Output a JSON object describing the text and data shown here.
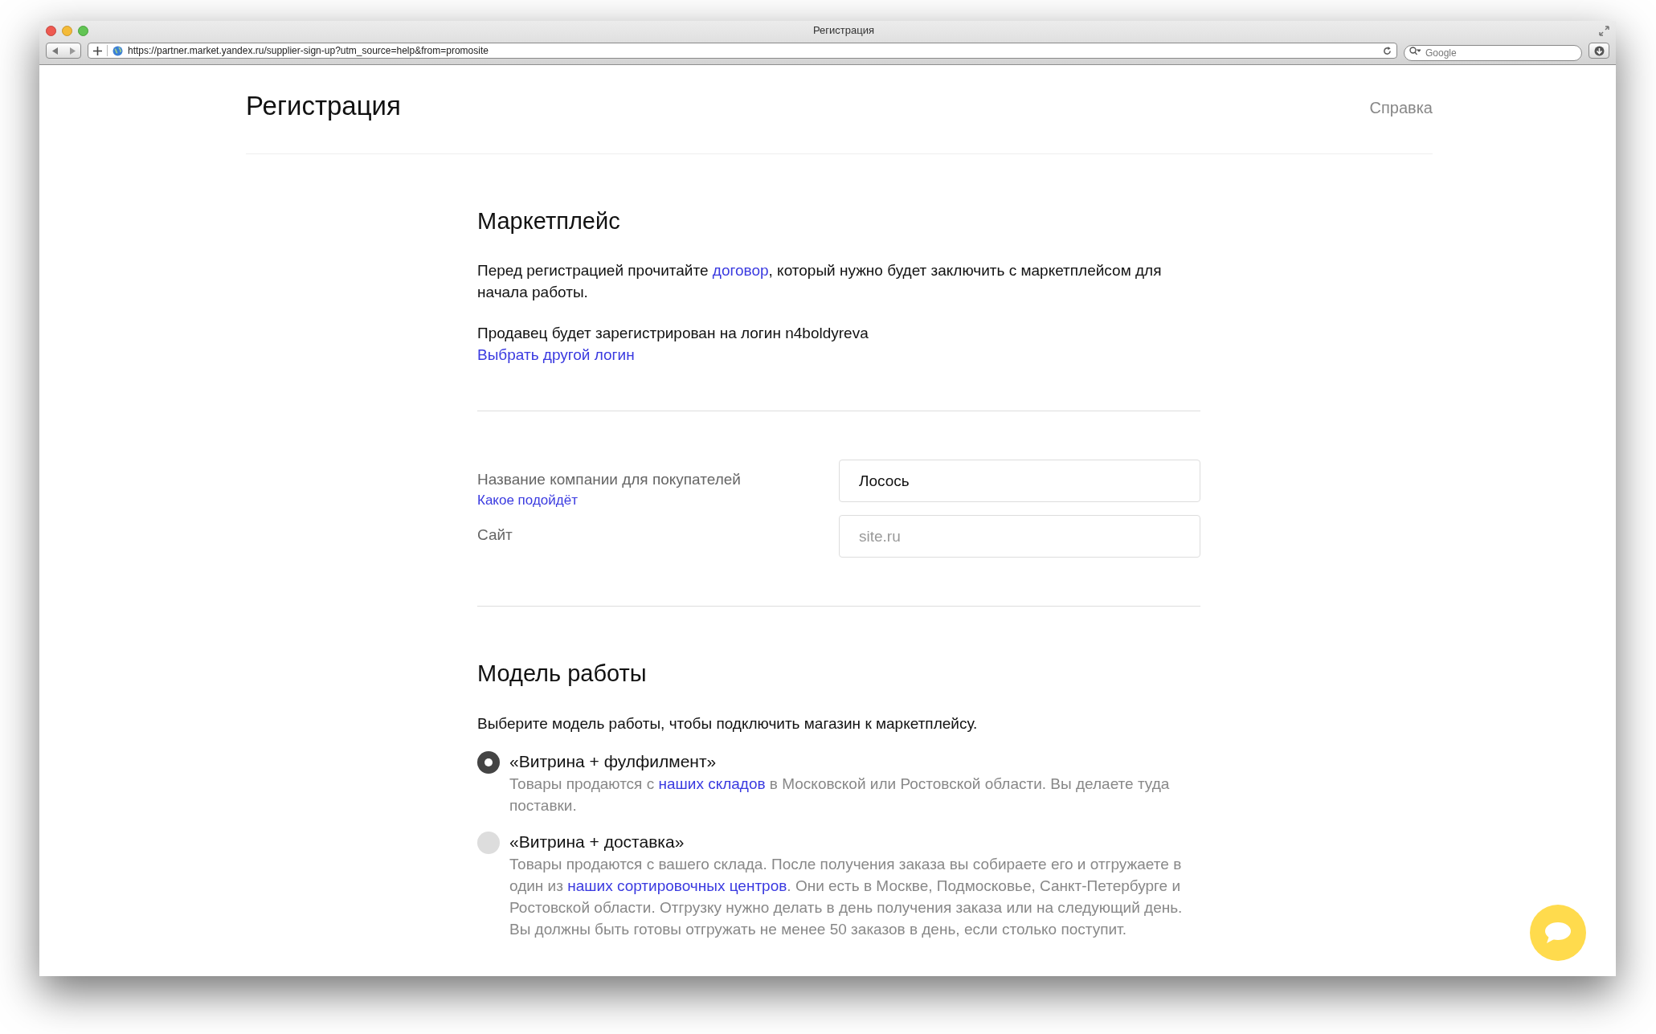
{
  "browser": {
    "title": "Регистрация",
    "url": "https://partner.market.yandex.ru/supplier-sign-up?utm_source=help&from=promosite",
    "search": {
      "placeholder": "Google"
    }
  },
  "header": {
    "title": "Регистрация",
    "help_link": "Справка"
  },
  "marketplace": {
    "heading": "Маркетплейс",
    "intro": [
      {
        "kind": "text",
        "text": "Перед регистрацией прочитайте "
      },
      {
        "kind": "link",
        "text": "договор"
      },
      {
        "kind": "text",
        "text": ", который нужно будет заключить с маркетплейсом для начала работы."
      }
    ],
    "login_text": "Продавец будет зарегистрирован на логин n4boldyreva",
    "change_login_link": "Выбрать другой логин"
  },
  "form": {
    "fields": [
      {
        "label": "Название компании для покупателей",
        "hint_link": "Какое подойдёт",
        "value": "Лосось"
      },
      {
        "label": "Сайт",
        "placeholder": "site.ru"
      }
    ]
  },
  "model": {
    "heading": "Модель работы",
    "intro": "Выберите модель работы, чтобы подключить магазин к маркетплейсу.",
    "options": [
      {
        "label": "«Витрина + фулфилмент»",
        "selected": true,
        "description": [
          {
            "kind": "text",
            "text": "Товары продаются с "
          },
          {
            "kind": "link",
            "text": "наших складов"
          },
          {
            "kind": "text",
            "text": " в Московской или Ростовской области. Вы делаете туда поставки."
          }
        ]
      },
      {
        "label": "«Витрина + доставка»",
        "selected": false,
        "description": [
          {
            "kind": "text",
            "text": "Товары продаются с вашего склада. После получения заказа вы собираете его и отгружаете в один из "
          },
          {
            "kind": "link",
            "text": "наших сортировочных центров"
          },
          {
            "kind": "text",
            "text": ". Они есть в Москве, Подмосковье, Санкт-Петербурге и Ростовской области. Отгрузку нужно делать в день получения заказа или на следующий день. Вы должны быть готовы отгружать не менее 50 заказов в день, если столько поступит."
          }
        ]
      }
    ]
  }
}
